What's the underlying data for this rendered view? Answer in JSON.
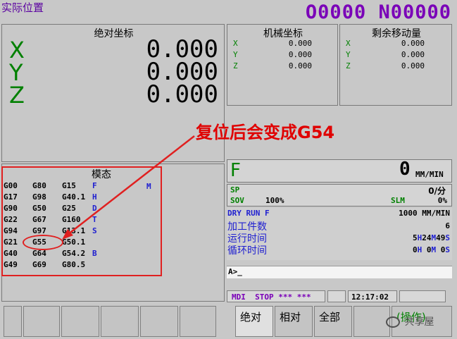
{
  "header": {
    "title": "实际位置",
    "program": "O0000 N00000"
  },
  "absolute": {
    "label": "绝对坐标",
    "axes": [
      {
        "name": "X",
        "value": "0.000"
      },
      {
        "name": "Y",
        "value": "0.000"
      },
      {
        "name": "Z",
        "value": "0.000"
      }
    ]
  },
  "machine": {
    "label": "机械坐标",
    "axes": [
      {
        "name": "X",
        "value": "0.000"
      },
      {
        "name": "Y",
        "value": "0.000"
      },
      {
        "name": "Z",
        "value": "0.000"
      }
    ]
  },
  "remaining": {
    "label": "剩余移动量",
    "axes": [
      {
        "name": "X",
        "value": "0.000"
      },
      {
        "name": "Y",
        "value": "0.000"
      },
      {
        "name": "Z",
        "value": "0.000"
      }
    ]
  },
  "annotation": "复位后会变成G54",
  "modal": {
    "label": "模态",
    "rows": [
      [
        "G00",
        "G80",
        "G15",
        "F"
      ],
      [
        "G17",
        "G98",
        "G40.1",
        "H"
      ],
      [
        "G90",
        "G50",
        "G25",
        "D"
      ],
      [
        "G22",
        "G67",
        "G160",
        "T"
      ],
      [
        "G94",
        "G97",
        "G13.1",
        "S"
      ],
      [
        "G21",
        "G55",
        "G50.1",
        ""
      ],
      [
        "G40",
        "G64",
        "G54.2",
        "B"
      ],
      [
        "G49",
        "G69",
        "G80.5",
        ""
      ]
    ],
    "m_label": "M"
  },
  "feed": {
    "label": "F",
    "value": "0",
    "unit": "MM/MIN"
  },
  "spindle": {
    "sp_label": "SP",
    "sp_value": "0/分",
    "sov_label": "SOV",
    "sov_value": "100%",
    "slm_label": "SLM",
    "slm_value": "0%"
  },
  "dry_run": {
    "label": "DRY RUN F",
    "value": "1000 MM/MIN"
  },
  "counters": {
    "parts_label": "加工件数",
    "parts_value": "6",
    "run_label": "运行时间",
    "run_h": "5",
    "run_m": "24",
    "run_s": "49",
    "cycle_label": "循环时间",
    "cycle_h": "0",
    "cycle_m": "0",
    "cycle_s": "0"
  },
  "input": {
    "prompt": "A>_"
  },
  "status": {
    "mode": "MDI",
    "state": "STOP",
    "stars1": "***",
    "stars2": "***",
    "time": "12:17:02"
  },
  "softkeys": {
    "k1": "绝对",
    "k2": "相对",
    "k3": "全部",
    "k4": "(操作)"
  },
  "watermark": "共享屋",
  "colors": {
    "axis_green": "#008000",
    "header_purple": "#7a00b8",
    "modal_blue": "#2020d0",
    "annotation_red": "#e00000"
  }
}
